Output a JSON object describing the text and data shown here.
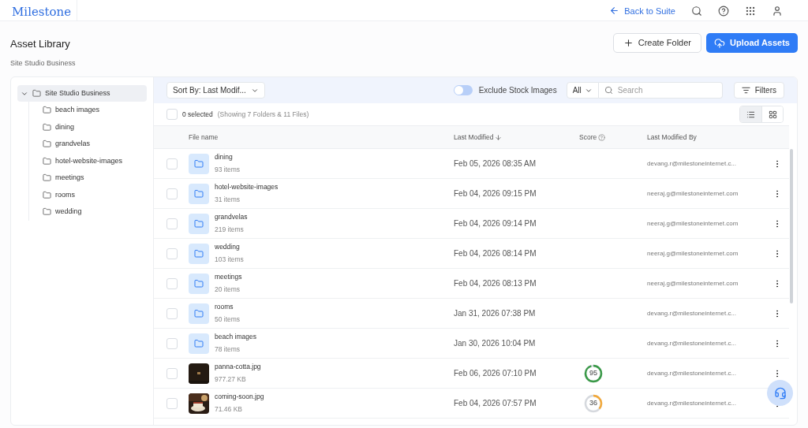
{
  "header": {
    "logo": "Milestone",
    "back_link": "Back to Suite"
  },
  "page": {
    "title": "Asset Library",
    "subtitle": "Site Studio Business",
    "buttons": [
      {
        "kind": "secondary",
        "label": "Create Folder"
      },
      {
        "kind": "primary",
        "label": "Upload Assets"
      }
    ]
  },
  "tree": {
    "label": "Site Studio Business",
    "expanded": true,
    "selected": true,
    "children": [
      {
        "label": "beach images",
        "selected": false
      },
      {
        "label": "dining",
        "selected": false
      },
      {
        "label": "grandvelas",
        "selected": false
      },
      {
        "label": "hotel-website-images",
        "selected": false
      },
      {
        "label": "meetings",
        "selected": false
      },
      {
        "label": "rooms",
        "selected": false
      },
      {
        "label": "wedding",
        "selected": false
      }
    ]
  },
  "toolbar": {
    "sort": "Sort By: Last Modif...",
    "exclude_stock": {
      "label": "Exclude Stock Images",
      "on": false
    },
    "type_filter": "All",
    "search": {
      "placeholder": "Search"
    },
    "filters": "Filters"
  },
  "selection": {
    "count": "0 selected",
    "summary": "(Showing 7 Folders & 11 Files)",
    "checked": false
  },
  "view_modes": [
    {
      "kind": "list",
      "selected": true
    },
    {
      "kind": "grid",
      "selected": false
    }
  ],
  "table": {
    "columns": [
      "File name",
      "Last Modified",
      "Score",
      "Last Modified By"
    ],
    "rows": [
      {
        "kind": "folder",
        "name": "dining",
        "meta": "93 items",
        "modified": "Feb 05, 2026 08:35 AM",
        "by": "devang.r@milestoneinternet.c...",
        "checked": false
      },
      {
        "kind": "folder",
        "name": "hotel-website-images",
        "meta": "31 items",
        "modified": "Feb 04, 2026 09:15 PM",
        "by": "neeraj.g@milestoneinternet.com",
        "checked": false
      },
      {
        "kind": "folder",
        "name": "grandvelas",
        "meta": "219 items",
        "modified": "Feb 04, 2026 09:14 PM",
        "by": "neeraj.g@milestoneinternet.com",
        "checked": false
      },
      {
        "kind": "folder",
        "name": "wedding",
        "meta": "103 items",
        "modified": "Feb 04, 2026 08:14 PM",
        "by": "neeraj.g@milestoneinternet.com",
        "checked": false
      },
      {
        "kind": "folder",
        "name": "meetings",
        "meta": "20 items",
        "modified": "Feb 04, 2026 08:13 PM",
        "by": "neeraj.g@milestoneinternet.com",
        "checked": false
      },
      {
        "kind": "folder",
        "name": "rooms",
        "meta": "50 items",
        "modified": "Jan 31, 2026 07:38 PM",
        "by": "devang.r@milestoneinternet.c...",
        "checked": false
      },
      {
        "kind": "folder",
        "name": "beach images",
        "meta": "78 items",
        "modified": "Jan 30, 2026 10:04 PM",
        "by": "devang.r@milestoneinternet.c...",
        "checked": false
      },
      {
        "name": "panna-cotta.jpg",
        "meta": "977.27 KB",
        "modified": "Feb 06, 2026 07:10 PM",
        "score": {
          "value": "95",
          "color": "#3a9a48"
        },
        "by": "devang.r@milestoneinternet.c...",
        "checked": false
      },
      {
        "name": "coming-soon.jpg",
        "meta": "71.46 KB",
        "modified": "Feb 04, 2026 07:57 PM",
        "score": {
          "value": "36",
          "color": "#f2a93b"
        },
        "by": "devang.r@milestoneinternet.c...",
        "checked": false
      }
    ]
  }
}
